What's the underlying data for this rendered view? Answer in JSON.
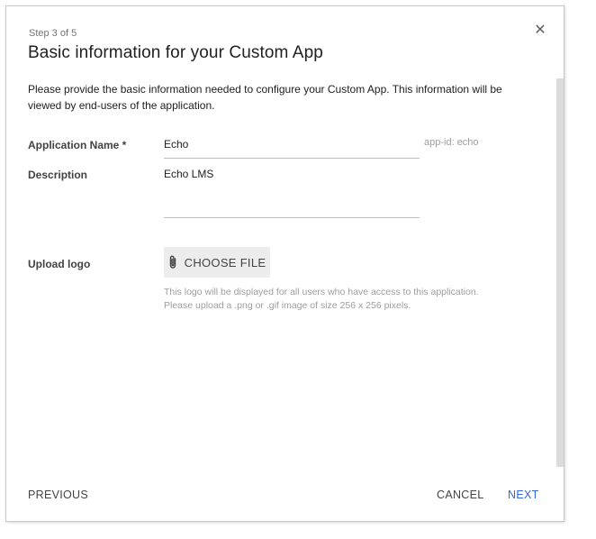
{
  "dialog": {
    "step_label": "Step 3 of 5",
    "title": "Basic information for your Custom App",
    "close_icon": "close-icon"
  },
  "intro_text": "Please provide the basic information needed to configure your Custom App. This information will be viewed by end-users of the application.",
  "form": {
    "app_name": {
      "label": "Application Name *",
      "value": "Echo",
      "app_id": "app-id:  echo"
    },
    "description": {
      "label": "Description",
      "value": "Echo LMS"
    },
    "upload_logo": {
      "label": "Upload logo",
      "button_label": "CHOOSE FILE",
      "button_icon": "paperclip-icon",
      "hint_line1": "This logo will be displayed for all users who have access to this application.",
      "hint_line2": "Please upload a .png or .gif image of size 256 x 256 pixels."
    }
  },
  "footer": {
    "previous_label": "PREVIOUS",
    "cancel_label": "CANCEL",
    "next_label": "NEXT"
  },
  "colors": {
    "accent": "#3367d6",
    "text": "#212121",
    "muted": "#9e9e9e",
    "button_bg": "#ececec"
  }
}
